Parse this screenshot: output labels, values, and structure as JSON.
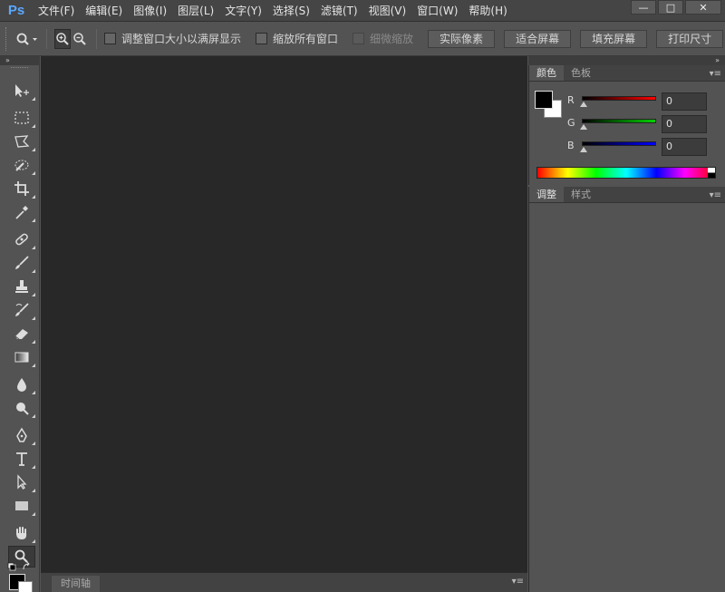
{
  "app": {
    "logo": "Ps"
  },
  "menu": [
    "文件(F)",
    "编辑(E)",
    "图像(I)",
    "图层(L)",
    "文字(Y)",
    "选择(S)",
    "滤镜(T)",
    "视图(V)",
    "窗口(W)",
    "帮助(H)"
  ],
  "window_controls": {
    "minimize": "—",
    "maximize": "□",
    "close": "✕"
  },
  "options_bar": {
    "checkboxes": [
      {
        "label": "调整窗口大小以满屏显示",
        "checked": false,
        "disabled": false
      },
      {
        "label": "缩放所有窗口",
        "checked": false,
        "disabled": false
      },
      {
        "label": "细微缩放",
        "checked": false,
        "disabled": true
      }
    ],
    "buttons": [
      "实际像素",
      "适合屏幕",
      "填充屏幕",
      "打印尺寸"
    ]
  },
  "panel_collapse": {
    "left": "»",
    "right": "»"
  },
  "tools": [
    "move-tool",
    "marquee-tool",
    "lasso-tool",
    "quick-selection-tool",
    "crop-tool",
    "eyedropper-tool",
    "healing-brush-tool",
    "brush-tool",
    "clone-stamp-tool",
    "history-brush-tool",
    "eraser-tool",
    "gradient-tool",
    "blur-tool",
    "dodge-tool",
    "pen-tool",
    "type-tool",
    "path-selection-tool",
    "rectangle-tool",
    "hand-tool",
    "zoom-tool"
  ],
  "timeline": {
    "tab": "时间轴"
  },
  "color_panel": {
    "tabs": [
      "颜色",
      "色板"
    ],
    "active_tab": "颜色",
    "sliders": [
      {
        "label": "R",
        "value": "0",
        "color": "#ff0000"
      },
      {
        "label": "G",
        "value": "0",
        "color": "#00c000"
      },
      {
        "label": "B",
        "value": "0",
        "color": "#0000ff"
      }
    ],
    "foreground": "#000000",
    "background": "#ffffff"
  },
  "adjust_panel": {
    "tabs": [
      "调整",
      "样式"
    ],
    "active_tab": "调整"
  },
  "panel_menu_icon": "▾≡"
}
